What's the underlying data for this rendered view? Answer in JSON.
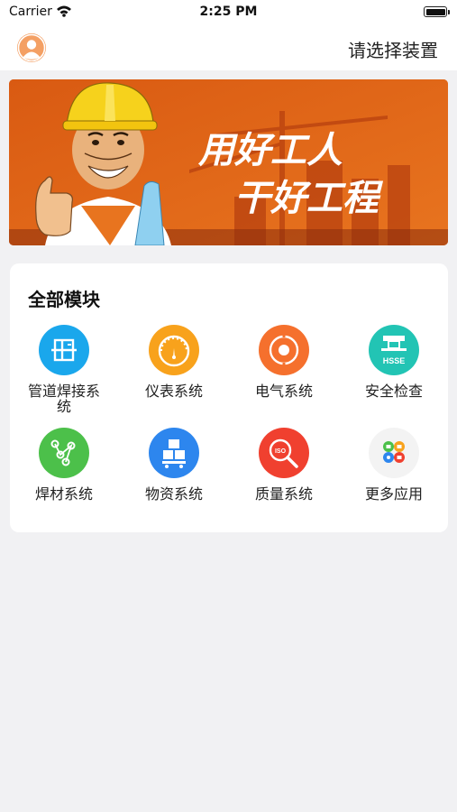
{
  "status_bar": {
    "carrier": "Carrier",
    "time": "2:25 PM"
  },
  "nav": {
    "action_label": "请选择装置"
  },
  "banner": {
    "line1": "用好工人",
    "line2": "干好工程"
  },
  "modules": {
    "title": "全部模块",
    "items": [
      {
        "label": "管道焊接系统",
        "icon": "pipe-welding-icon",
        "color": "#1aa7ec"
      },
      {
        "label": "仪表系统",
        "icon": "gauge-icon",
        "color": "#f8a21c"
      },
      {
        "label": "电气系统",
        "icon": "electric-icon",
        "color": "#f5702d"
      },
      {
        "label": "安全检查",
        "icon": "hsse-icon",
        "color": "#22c4b4",
        "badge": "HSSE"
      },
      {
        "label": "焊材系统",
        "icon": "welding-material-icon",
        "color": "#4cc04a"
      },
      {
        "label": "物资系统",
        "icon": "materials-icon",
        "color": "#2d86ee"
      },
      {
        "label": "质量系统",
        "icon": "quality-icon",
        "color": "#f0402f",
        "badge": "ISO"
      },
      {
        "label": "更多应用",
        "icon": "more-apps-icon",
        "color": "#f3f3f3"
      }
    ]
  }
}
